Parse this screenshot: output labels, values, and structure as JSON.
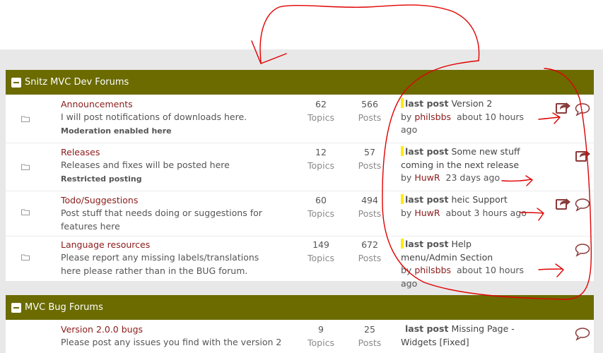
{
  "categories": [
    {
      "title": "Snitz MVC Dev Forums",
      "forums": [
        {
          "name": "Announcements",
          "description": "I will post notifications of downloads here.",
          "note": "Moderation enabled here",
          "topics": "62",
          "topics_label": "Topics",
          "posts": "566",
          "posts_label": "Posts",
          "last_post": {
            "label": "last post",
            "title": "Version 2",
            "by": "by",
            "user": "philsbbs",
            "time": "about 10 hours ago"
          }
        },
        {
          "name": "Releases",
          "description": "Releases and fixes will be posted here",
          "note": "Restricted posting",
          "topics": "12",
          "topics_label": "Topics",
          "posts": "57",
          "posts_label": "Posts",
          "last_post": {
            "label": "last post",
            "title": "Some new stuff coming in the next release",
            "by": "by",
            "user": "HuwR",
            "time": "23 days ago"
          }
        },
        {
          "name": "Todo/Suggestions",
          "description": "Post stuff that needs doing or suggestions for features here",
          "note": "",
          "topics": "60",
          "topics_label": "Topics",
          "posts": "494",
          "posts_label": "Posts",
          "last_post": {
            "label": "last post",
            "title": "heic Support",
            "by": "by",
            "user": "HuwR",
            "time": "about 3 hours ago"
          }
        },
        {
          "name": "Language resources",
          "description": "Please report any missing labels/translations here please rather than in the BUG forum.",
          "note": "",
          "topics": "149",
          "topics_label": "Topics",
          "posts": "672",
          "posts_label": "Posts",
          "last_post": {
            "label": "last post",
            "title": "Help menu/Admin Section",
            "by": "by",
            "user": "philsbbs",
            "time": "about 10 hours ago"
          }
        }
      ]
    },
    {
      "title": "MVC Bug Forums",
      "forums": [
        {
          "name": "Version 2.0.0 bugs",
          "description": "Please post any issues you find with the version 2",
          "note": "",
          "topics": "9",
          "topics_label": "Topics",
          "posts": "25",
          "posts_label": "Posts",
          "last_post": {
            "label": "last post",
            "title": "Missing Page - Widgets [Fixed]",
            "by": "",
            "user": "",
            "time": ""
          }
        }
      ]
    }
  ],
  "icons": {
    "folder": "folder-icon",
    "subscribe": "share-arrow-icon",
    "chat": "speech-bubble-icon"
  },
  "colors": {
    "header_bg": "#6b6b00",
    "link": "#8b1a1a",
    "highlight": "#ffeb00",
    "page_bg": "#e8e8e8",
    "annotation": "#e00000"
  }
}
